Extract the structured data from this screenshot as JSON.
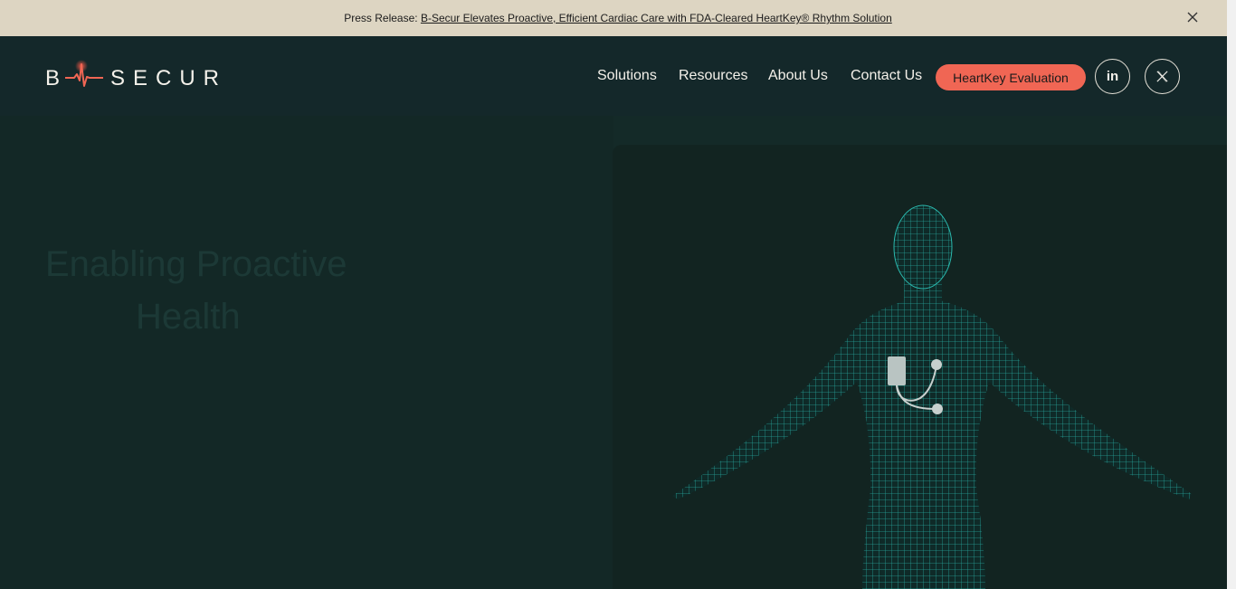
{
  "banner": {
    "prefix": "Press Release:",
    "link_text": "B-Secur Elevates Proactive, Efficient Cardiac Care with FDA-Cleared HeartKey® Rhythm Solution"
  },
  "header": {
    "logo": {
      "left": "B",
      "right": "SECUR"
    },
    "nav": [
      "Solutions",
      "Resources",
      "About Us",
      "Contact Us"
    ],
    "cta_label": "HeartKey Evaluation",
    "social": {
      "linkedin": "in",
      "x": "X"
    }
  },
  "hero": {
    "title_line1": "Enabling Proactive",
    "title_line2": "Health"
  },
  "colors": {
    "accent": "#f06654",
    "banner_bg": "#ddd5c2",
    "header_bg": "#14282a",
    "hero_bg": "#132826",
    "mesh": "#2ab8ad"
  }
}
